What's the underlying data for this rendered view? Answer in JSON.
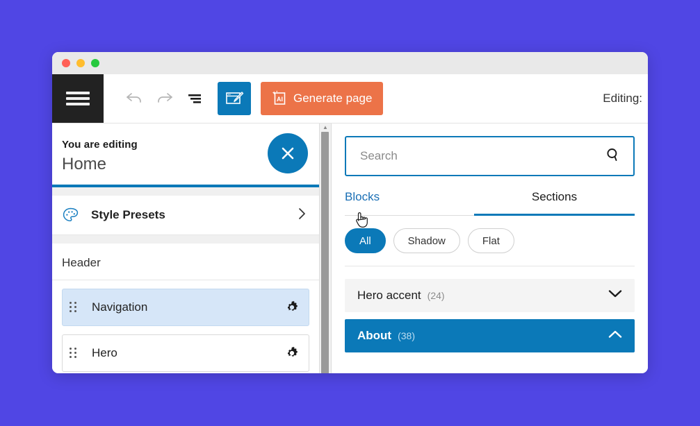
{
  "window": {
    "traffic_lights": [
      {
        "name": "close",
        "color": "#ff5f56"
      },
      {
        "name": "minimize",
        "color": "#ffbd2e"
      },
      {
        "name": "maximize",
        "color": "#27c93f"
      }
    ]
  },
  "toolbar": {
    "menu_icon": "hamburger-menu-icon",
    "undo_icon": "undo-arrow-icon",
    "redo_icon": "redo-arrow-icon",
    "align_icon": "align-lines-icon",
    "preview_icon": "browser-paintbrush-icon",
    "generate_icon": "ai-document-icon",
    "generate_label": "Generate page",
    "editing_label": "Editing:",
    "accent_blue": "#0b79b8",
    "accent_orange": "#ec7348"
  },
  "left_panel": {
    "eyebrow": "You are editing",
    "page_name": "Home",
    "close_icon": "close-x-icon",
    "style_presets": {
      "icon": "palette-icon",
      "label": "Style Presets",
      "chevron": "chevron-right-icon"
    },
    "group_title": "Header",
    "blocks": [
      {
        "label": "Navigation",
        "selected": true,
        "drag_icon": "drag-handle-icon",
        "gear_icon": "gear-icon"
      },
      {
        "label": "Hero",
        "selected": false,
        "drag_icon": "drag-handle-icon",
        "gear_icon": "gear-icon"
      }
    ]
  },
  "right_panel": {
    "search": {
      "placeholder": "Search",
      "value": "",
      "icon": "search-icon"
    },
    "tabs": [
      {
        "label": "Blocks",
        "active": false
      },
      {
        "label": "Sections",
        "active": true
      }
    ],
    "chips": [
      {
        "label": "All",
        "active": true
      },
      {
        "label": "Shadow",
        "active": false
      },
      {
        "label": "Flat",
        "active": false
      }
    ],
    "accordion": [
      {
        "title": "Hero accent",
        "count": "(24)",
        "expanded": false,
        "chevron": "chevron-down-icon"
      },
      {
        "title": "About",
        "count": "(38)",
        "expanded": true,
        "chevron": "chevron-up-icon"
      }
    ]
  },
  "cursor": {
    "icon": "pointing-hand-cursor"
  }
}
